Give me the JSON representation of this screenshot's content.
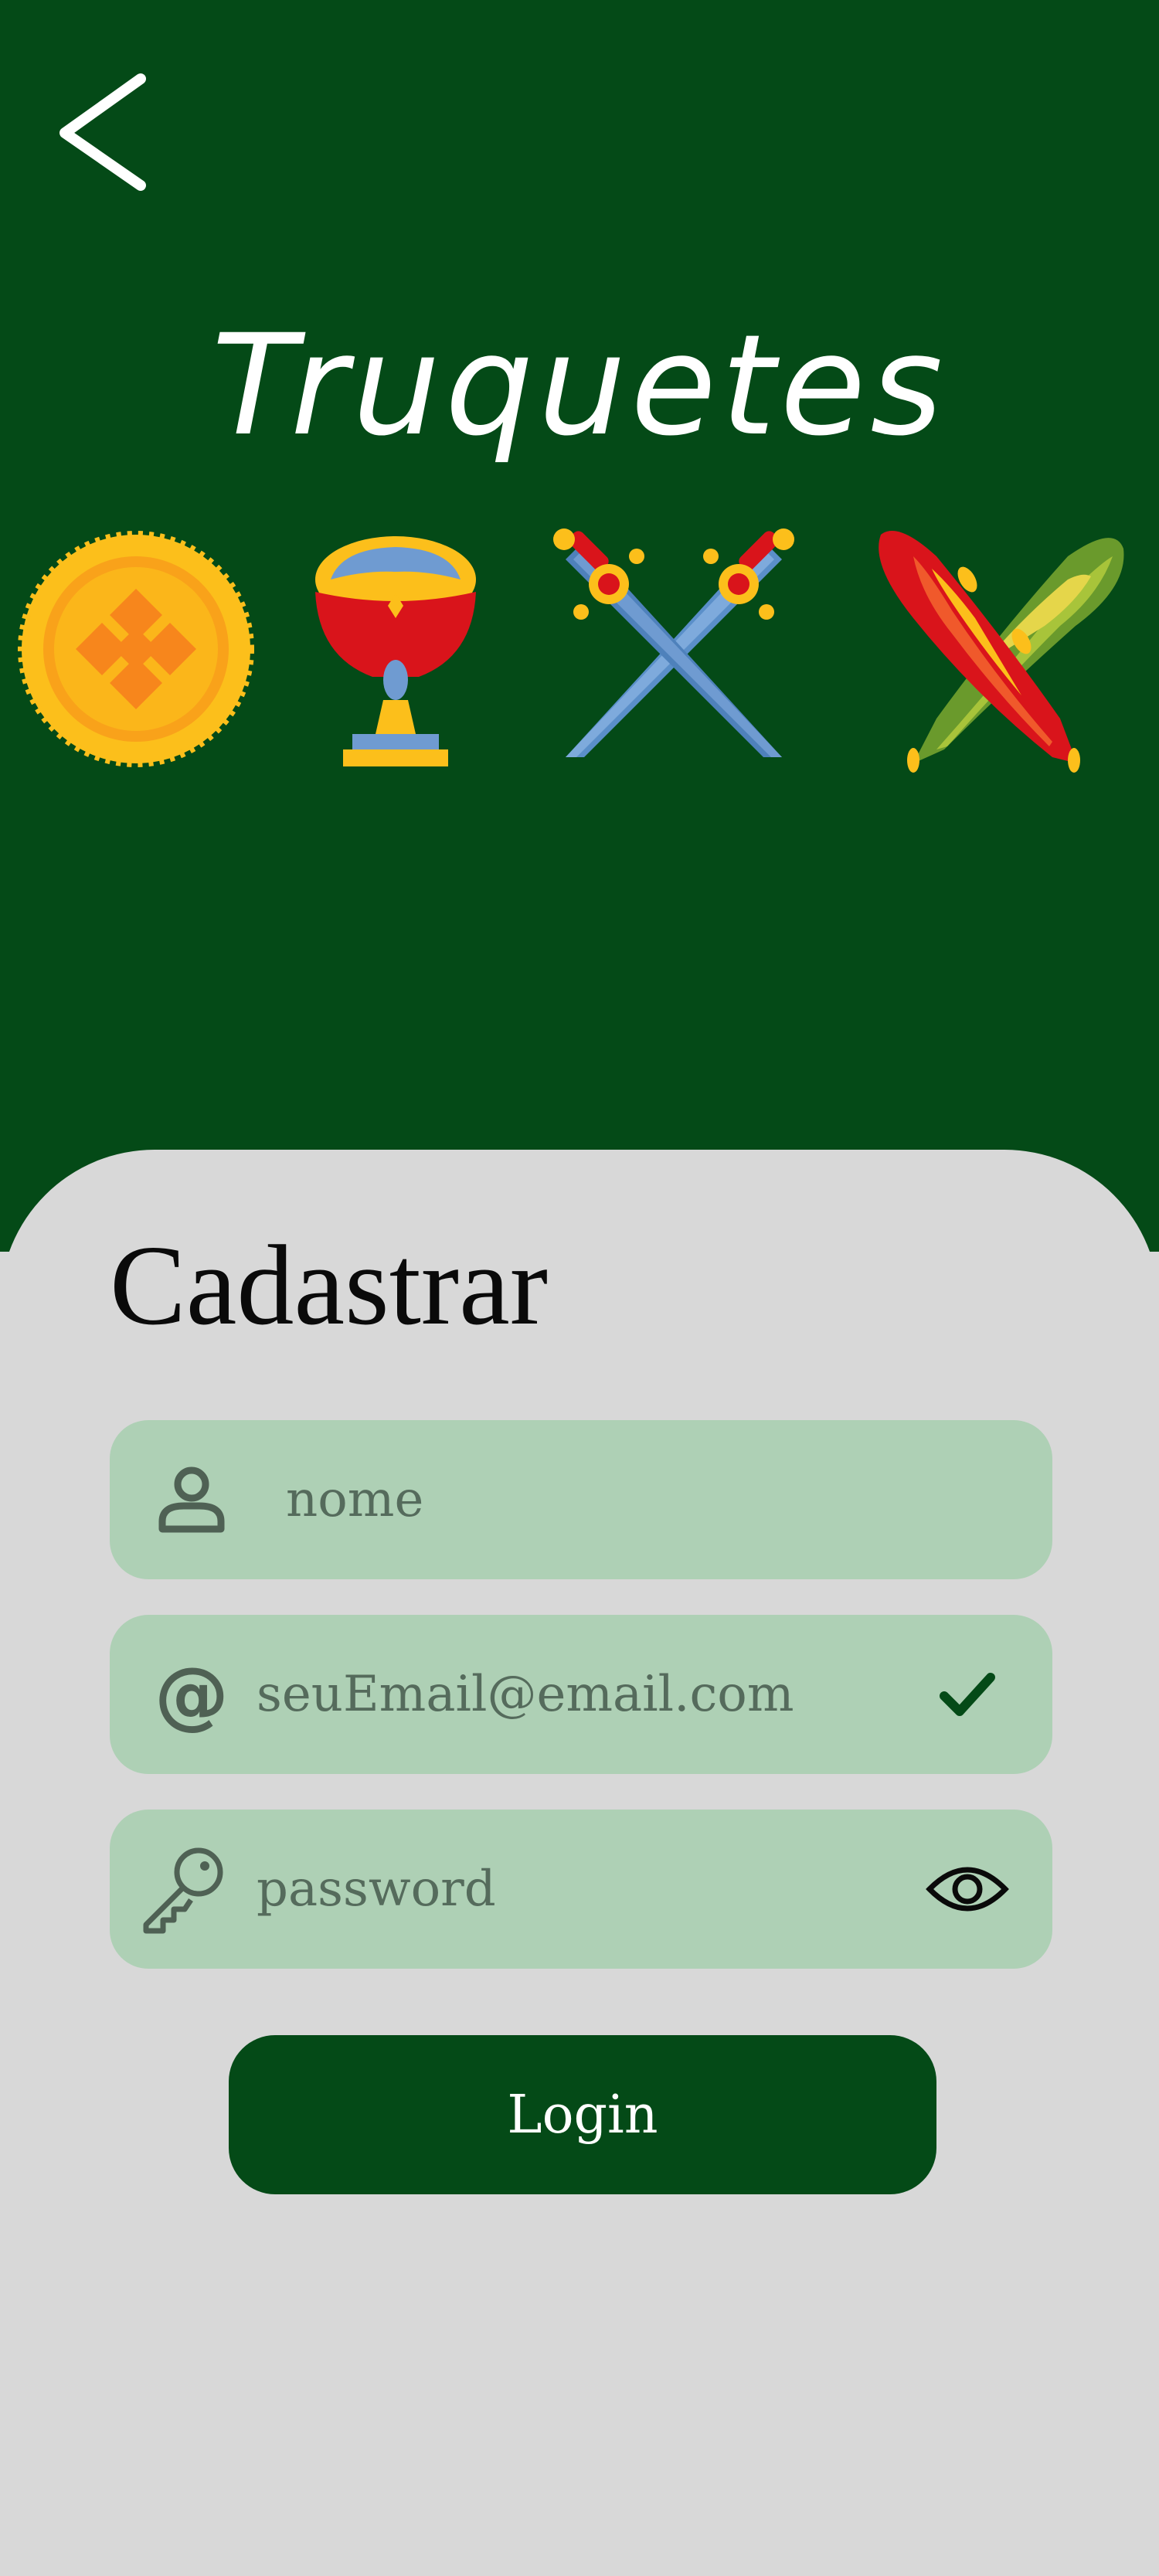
{
  "header": {
    "app_title": "Truquetes",
    "background": "#044a17",
    "back_icon": "chevron-left-icon",
    "suits": [
      "coin-medal-icon",
      "chalice-cup-icon",
      "crossed-swords-icon",
      "crossed-clubs-icon"
    ]
  },
  "form": {
    "title": "Cadastrar",
    "name_field": {
      "placeholder": "nome",
      "icon": "user-icon"
    },
    "email_field": {
      "value": "seuEmail@email.com",
      "icon": "at-sign-icon",
      "status_icon": "check-icon"
    },
    "password_field": {
      "placeholder": "password",
      "icon": "key-icon",
      "toggle_icon": "eye-icon"
    },
    "login_button": "Login"
  },
  "colors": {
    "primary": "#044a17",
    "field_bg": "#aed0b5",
    "page_bg": "#d8d8d8"
  }
}
